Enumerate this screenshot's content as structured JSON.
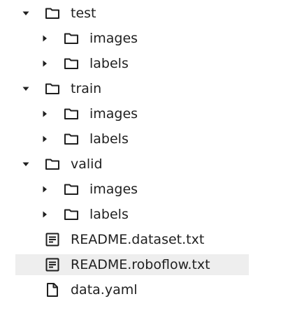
{
  "tree": {
    "test": {
      "label": "test",
      "images": "images",
      "labels": "labels"
    },
    "train": {
      "label": "train",
      "images": "images",
      "labels": "labels"
    },
    "valid": {
      "label": "valid",
      "images": "images",
      "labels": "labels"
    },
    "files": {
      "readme_dataset": "README.dataset.txt",
      "readme_roboflow": "README.roboflow.txt",
      "data_yaml": "data.yaml"
    }
  },
  "icons": {
    "expanded": "caret-down-icon",
    "collapsed": "caret-right-icon",
    "folder": "folder-icon",
    "text_file": "text-file-icon",
    "file": "file-icon"
  },
  "colors": {
    "text": "#1f1f1f",
    "icon": "#1f1f1f",
    "hover_row": "#eeeeee"
  }
}
